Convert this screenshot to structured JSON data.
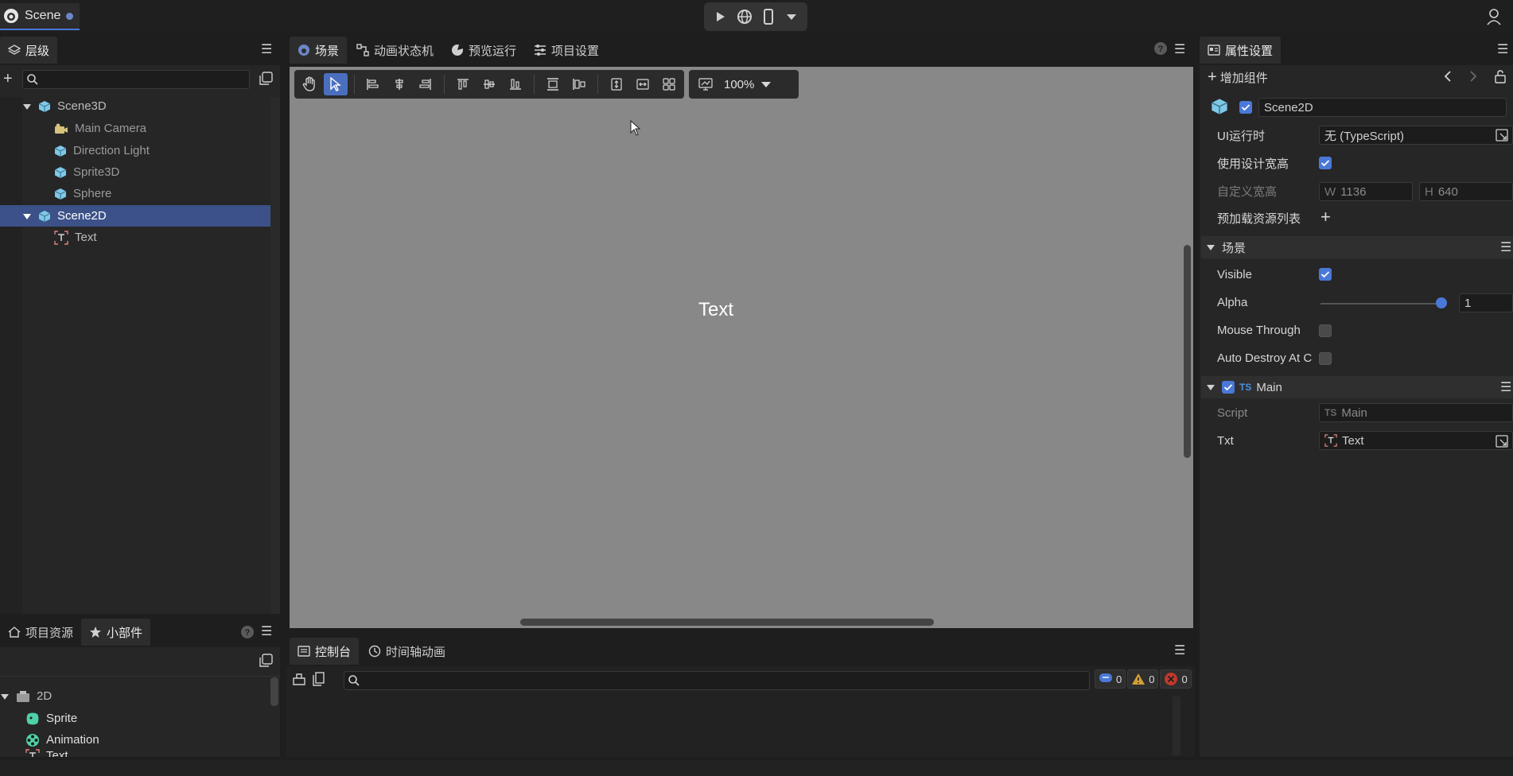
{
  "titlebar": {
    "scene_tab": "Scene"
  },
  "hierarchy": {
    "tab_label": "层级",
    "search_placeholder": "",
    "items": [
      {
        "label": "Scene3D",
        "icon": "cube-icon"
      },
      {
        "label": "Main Camera",
        "icon": "camera-icon"
      },
      {
        "label": "Direction Light",
        "icon": "cube-icon"
      },
      {
        "label": "Sprite3D",
        "icon": "cube-icon"
      },
      {
        "label": "Sphere",
        "icon": "cube-icon"
      },
      {
        "label": "Scene2D",
        "icon": "cube-icon",
        "selected": true
      },
      {
        "label": "Text",
        "icon": "text-node-icon"
      }
    ]
  },
  "widgets": {
    "tabs": [
      "项目资源",
      "小部件"
    ],
    "active_tab": "小部件",
    "items": [
      {
        "label": "2D"
      },
      {
        "label": "Sprite"
      },
      {
        "label": "Animation"
      },
      {
        "label": "Text"
      }
    ]
  },
  "center": {
    "tabs": [
      "场景",
      "动画状态机",
      "预览运行",
      "项目设置"
    ],
    "active_tab": "场景",
    "zoom": "100%",
    "scene_text": "Text"
  },
  "console": {
    "tabs": [
      "控制台",
      "时间轴动画"
    ],
    "active_tab": "控制台",
    "info_count": "0",
    "warn_count": "0",
    "error_count": "0"
  },
  "inspector": {
    "tab_label": "属性设置",
    "add_component": "增加组件",
    "node_name": "Scene2D",
    "node_enabled": true,
    "props": {
      "ui_runtime_label": "UI运行时",
      "ui_runtime_value": "无 (TypeScript)",
      "use_design_size_label": "使用设计宽高",
      "use_design_size": true,
      "custom_size_label": "自定义宽高",
      "w_label": "W",
      "w_value": "1136",
      "h_label": "H",
      "h_value": "640",
      "preload_label": "预加载资源列表"
    },
    "scene_section": {
      "title": "场景",
      "visible_label": "Visible",
      "visible": true,
      "alpha_label": "Alpha",
      "alpha_value": "1",
      "alpha_level": 1,
      "mouse_through_label": "Mouse Through",
      "mouse_through": false,
      "auto_destroy_label": "Auto Destroy At C",
      "auto_destroy": false
    },
    "main_section": {
      "title": "Main",
      "ts_badge": "TS",
      "enabled": true,
      "script_label": "Script",
      "script_value": "Main",
      "txt_label": "Txt",
      "txt_value": "Text"
    }
  },
  "colors": {
    "accent": "#4a78d8",
    "selection": "#3b5187",
    "scene_bg": "#888888",
    "cube_icon": "#7fc8e8",
    "camera_icon": "#d6c27a"
  }
}
